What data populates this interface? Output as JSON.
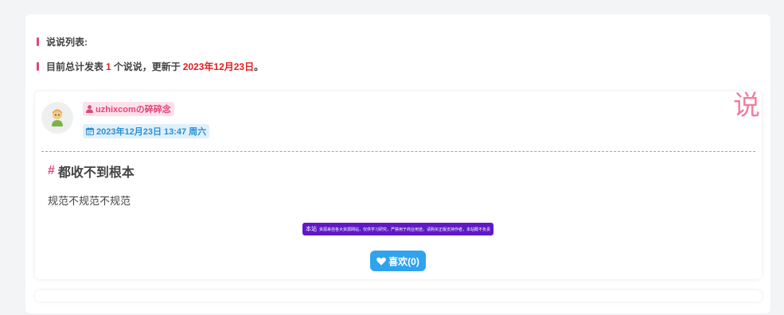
{
  "summary": {
    "list_label": "说说列表:",
    "count_prefix": "目前总计发表",
    "count": "1",
    "count_middle": "个说说，更新于",
    "updated_date": "2023年12月23日",
    "count_suffix": "。"
  },
  "post": {
    "corner_char": "说",
    "avatar_icon": "cartoon-avatar-icon",
    "author": "uzhixcomの碎碎念",
    "datetime": "2023年12月23日 13:47 周六",
    "title_hash": "#",
    "title": "都收不到根本",
    "body": "规范不规范不规范",
    "notice_prefix": "本站",
    "notice_text": "资源来自各大资源网站，仅供学习研究，严禁用于商业用途，请购买正版支持作者，本站概不负责",
    "like_label": "喜欢(0)"
  },
  "colors": {
    "accent_pink": "#e0457b",
    "accent_red": "#e02020",
    "accent_blue": "#2fa3ee",
    "banner_purple": "#6018c8"
  }
}
